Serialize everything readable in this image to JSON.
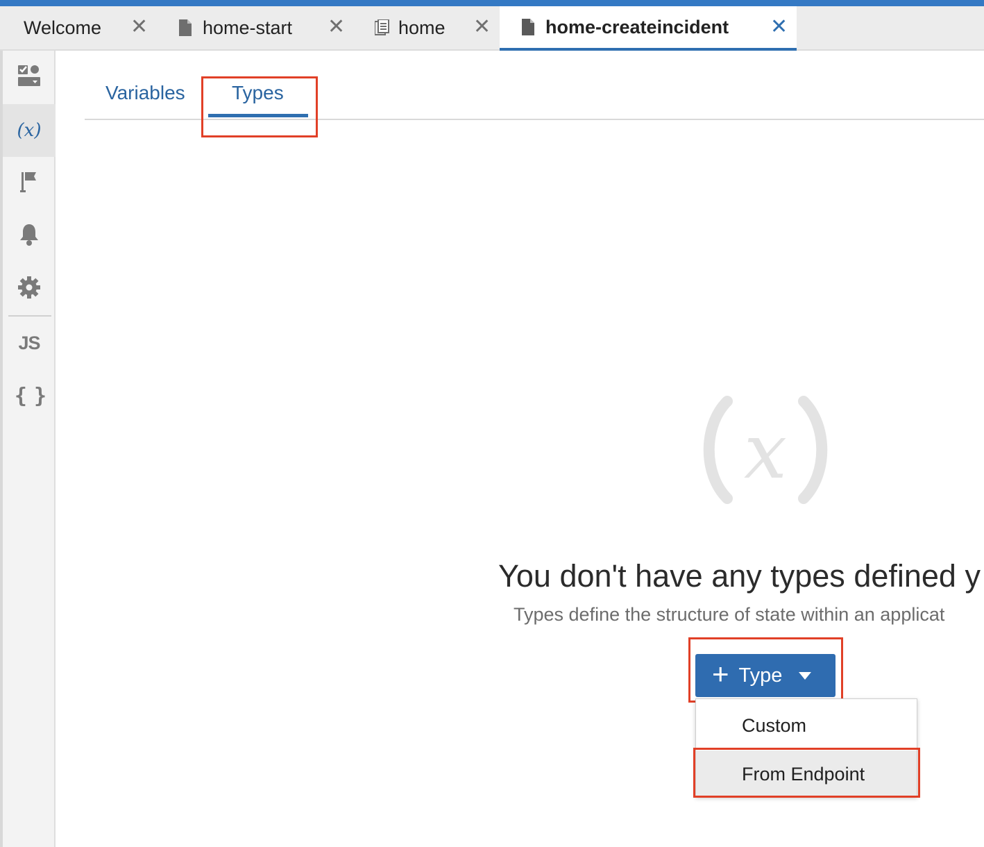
{
  "tabs": [
    {
      "label": "Welcome",
      "icon": "none",
      "active": false
    },
    {
      "label": "home-start",
      "icon": "file-icon",
      "active": false
    },
    {
      "label": "home",
      "icon": "pages-icon",
      "active": false
    },
    {
      "label": "home-createincident",
      "icon": "file-icon",
      "active": true
    }
  ],
  "tab_close_glyph": "✕",
  "sidebar": {
    "items": [
      {
        "name": "components-icon"
      },
      {
        "name": "variables-icon",
        "glyph": "(x)",
        "active": true
      },
      {
        "name": "flag-icon"
      },
      {
        "name": "bell-icon"
      },
      {
        "name": "gear-icon"
      },
      {
        "name": "javascript-icon",
        "glyph": "JS"
      },
      {
        "name": "json-icon",
        "glyph": "{ }"
      }
    ]
  },
  "subtabs": {
    "variables": "Variables",
    "types": "Types",
    "active": "Types"
  },
  "empty_state": {
    "icon_glyph": "(x)",
    "heading": "You don't have any types defined y",
    "description": "Types define the structure of state within an applicat"
  },
  "add_button": {
    "plus": "+",
    "label": "Type"
  },
  "menu": {
    "items": [
      {
        "label": "Custom",
        "hovered": false
      },
      {
        "label": "From Endpoint",
        "hovered": true
      }
    ]
  },
  "colors": {
    "accent": "#2f6fb0",
    "highlight": "#e14027"
  }
}
